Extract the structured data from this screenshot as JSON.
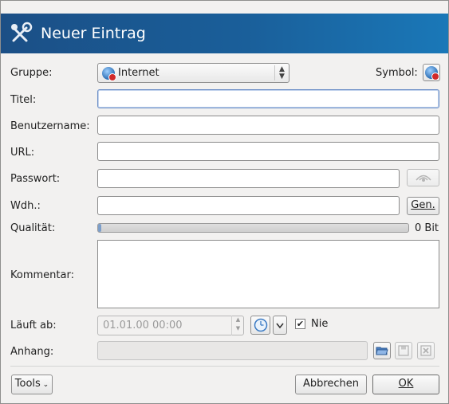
{
  "dialog": {
    "title": "Neuer Eintrag"
  },
  "group": {
    "label": "Gruppe:",
    "value": "Internet"
  },
  "symbol": {
    "label": "Symbol:"
  },
  "title_field": {
    "label": "Titel:",
    "value": ""
  },
  "username": {
    "label": "Benutzername:",
    "value": ""
  },
  "url": {
    "label": "URL:",
    "value": ""
  },
  "password": {
    "label": "Passwort:",
    "value": ""
  },
  "repeat": {
    "label": "Wdh.:",
    "value": "",
    "gen_label": "Gen."
  },
  "quality": {
    "label": "Qualität:",
    "value_text": "0 Bit",
    "fraction": 0.0
  },
  "comment": {
    "label": "Kommentar:",
    "value": ""
  },
  "expires": {
    "label": "Läuft ab:",
    "value": "01.01.00 00:00",
    "never_label": "Nie",
    "never_checked": true
  },
  "attachment": {
    "label": "Anhang:",
    "value": ""
  },
  "footer": {
    "tools_label": "Tools",
    "cancel_label": "Abbrechen",
    "ok_label": "OK"
  }
}
